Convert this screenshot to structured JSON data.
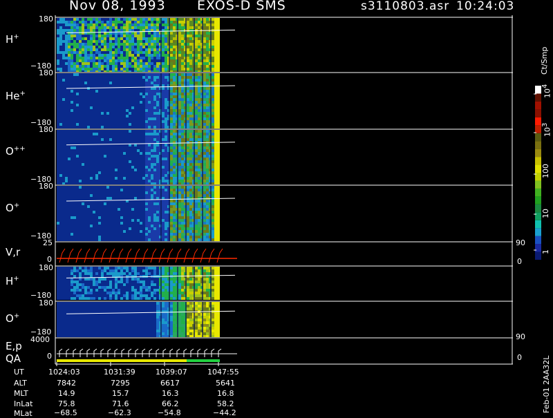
{
  "header": {
    "date": "Nov 08, 1993",
    "instrument": "EXOS-D SMS",
    "file": "s3110803.asr",
    "time": "10:24:03"
  },
  "panels": [
    {
      "label": "H",
      "sup": "+",
      "ymax": "180",
      "ymin": "−180"
    },
    {
      "label": "He",
      "sup": "+",
      "ymax": "180",
      "ymin": "−180"
    },
    {
      "label": "O",
      "sup": "++",
      "ymax": "180",
      "ymin": "−180"
    },
    {
      "label": "O",
      "sup": "+",
      "ymax": "180",
      "ymin": "−180"
    },
    {
      "label": "H",
      "sup": "+",
      "ymax": "180",
      "ymin": "−180"
    },
    {
      "label": "O",
      "sup": "+",
      "ymax": "180",
      "ymin": "−180"
    }
  ],
  "vr_panel": {
    "label": "V,r",
    "ymax": "25",
    "ymin": "0",
    "right_top": "90",
    "right_bottom": "0"
  },
  "ep_panel": {
    "label_top": "E,p",
    "label_bottom": "QA",
    "ymax": "4000",
    "ymin": "0",
    "right_top": "90",
    "right_bottom": "0"
  },
  "colorbar": {
    "unit": "Ct/Smp",
    "tick_labels": [
      "1",
      "10",
      "100",
      "10",
      "10"
    ],
    "tick_sups": [
      "",
      "",
      "",
      "3",
      "4"
    ]
  },
  "footer": {
    "rows": [
      {
        "name": "UT",
        "values": [
          "1024:03",
          "1031:39",
          "1039:07",
          "1047:55"
        ]
      },
      {
        "name": "ALT",
        "values": [
          "7842",
          "7295",
          "6617",
          "5641"
        ]
      },
      {
        "name": "MLT",
        "values": [
          "14.9",
          "15.7",
          "16.3",
          "16.8"
        ]
      },
      {
        "name": "InLat",
        "values": [
          "75.8",
          "71.6",
          "66.2",
          "58.2"
        ]
      },
      {
        "name": "MLat",
        "values": [
          "−68.5",
          "−62.3",
          "−54.8",
          "−44.2"
        ]
      }
    ],
    "stamp": "Feb-01 2AA32L"
  },
  "colors": {
    "background": "#000000",
    "low": "#0a2a8c",
    "mid": "#1a9acb",
    "green": "#22b04a",
    "olive": "#6b7a1a",
    "yellow": "#e8e800",
    "red_trace": "#ff2a00"
  },
  "chart_data": {
    "type": "heatmap",
    "title": "Nov 08, 1993 EXOS-D SMS",
    "xlabel": "UT",
    "x_ticks": [
      "1024:03",
      "1031:39",
      "1039:07",
      "1047:55"
    ],
    "panels": [
      "H+",
      "He+",
      "O++",
      "O+",
      "V,r",
      "H+",
      "O+",
      "E,p / QA"
    ],
    "y_range": [
      -180,
      180
    ],
    "color_scale": {
      "unit": "Ct/Smp",
      "log": true,
      "range": [
        1,
        10000
      ]
    }
  }
}
